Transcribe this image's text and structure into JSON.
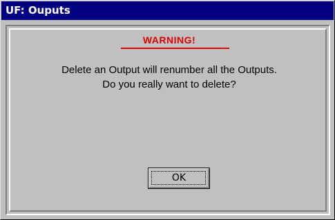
{
  "window": {
    "title": "UF: Ouputs"
  },
  "dialog": {
    "warning_title": "WARNING!",
    "message_line1": "Delete an Output will renumber all the Outputs.",
    "message_line2": "Do you really want to delete?",
    "ok_label": "OK"
  },
  "colors": {
    "titlebar": "#000080",
    "warning": "#e00000",
    "background": "#c0c0c0"
  }
}
